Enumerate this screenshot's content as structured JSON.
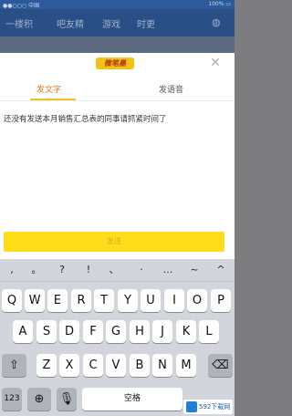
{
  "status": {
    "left": "●●○○○ 中国",
    "right": "100% ▭"
  },
  "background_nav": {
    "items": [
      "一楼积",
      "吧友精",
      "游戏",
      "时更"
    ]
  },
  "modal": {
    "brand": "微笔墨",
    "close_icon": "close-icon",
    "tabs": [
      {
        "label": "发文字",
        "active": true
      },
      {
        "label": "发语音",
        "active": false
      }
    ],
    "message": "还没有发送本月销售汇总表的同事请抓紧时间了",
    "send_label": "发送",
    "accent": "#ffdd1b"
  },
  "keyboard": {
    "punctuation": [
      ",",
      "。",
      "?",
      "!",
      "、",
      "·",
      "…",
      "~",
      "^"
    ],
    "row1": [
      "Q",
      "W",
      "E",
      "R",
      "T",
      "Y",
      "U",
      "I",
      "O",
      "P"
    ],
    "row2": [
      "A",
      "S",
      "D",
      "F",
      "G",
      "H",
      "J",
      "K",
      "L"
    ],
    "row3": [
      "Z",
      "X",
      "C",
      "V",
      "B",
      "N",
      "M"
    ],
    "shift_icon": "shift-icon",
    "delete_icon": "delete-icon",
    "numbers_label": "123",
    "globe_icon": "globe-icon",
    "mic_icon": "microphone-icon",
    "space_label": "空格",
    "watermark": "592下载网"
  }
}
